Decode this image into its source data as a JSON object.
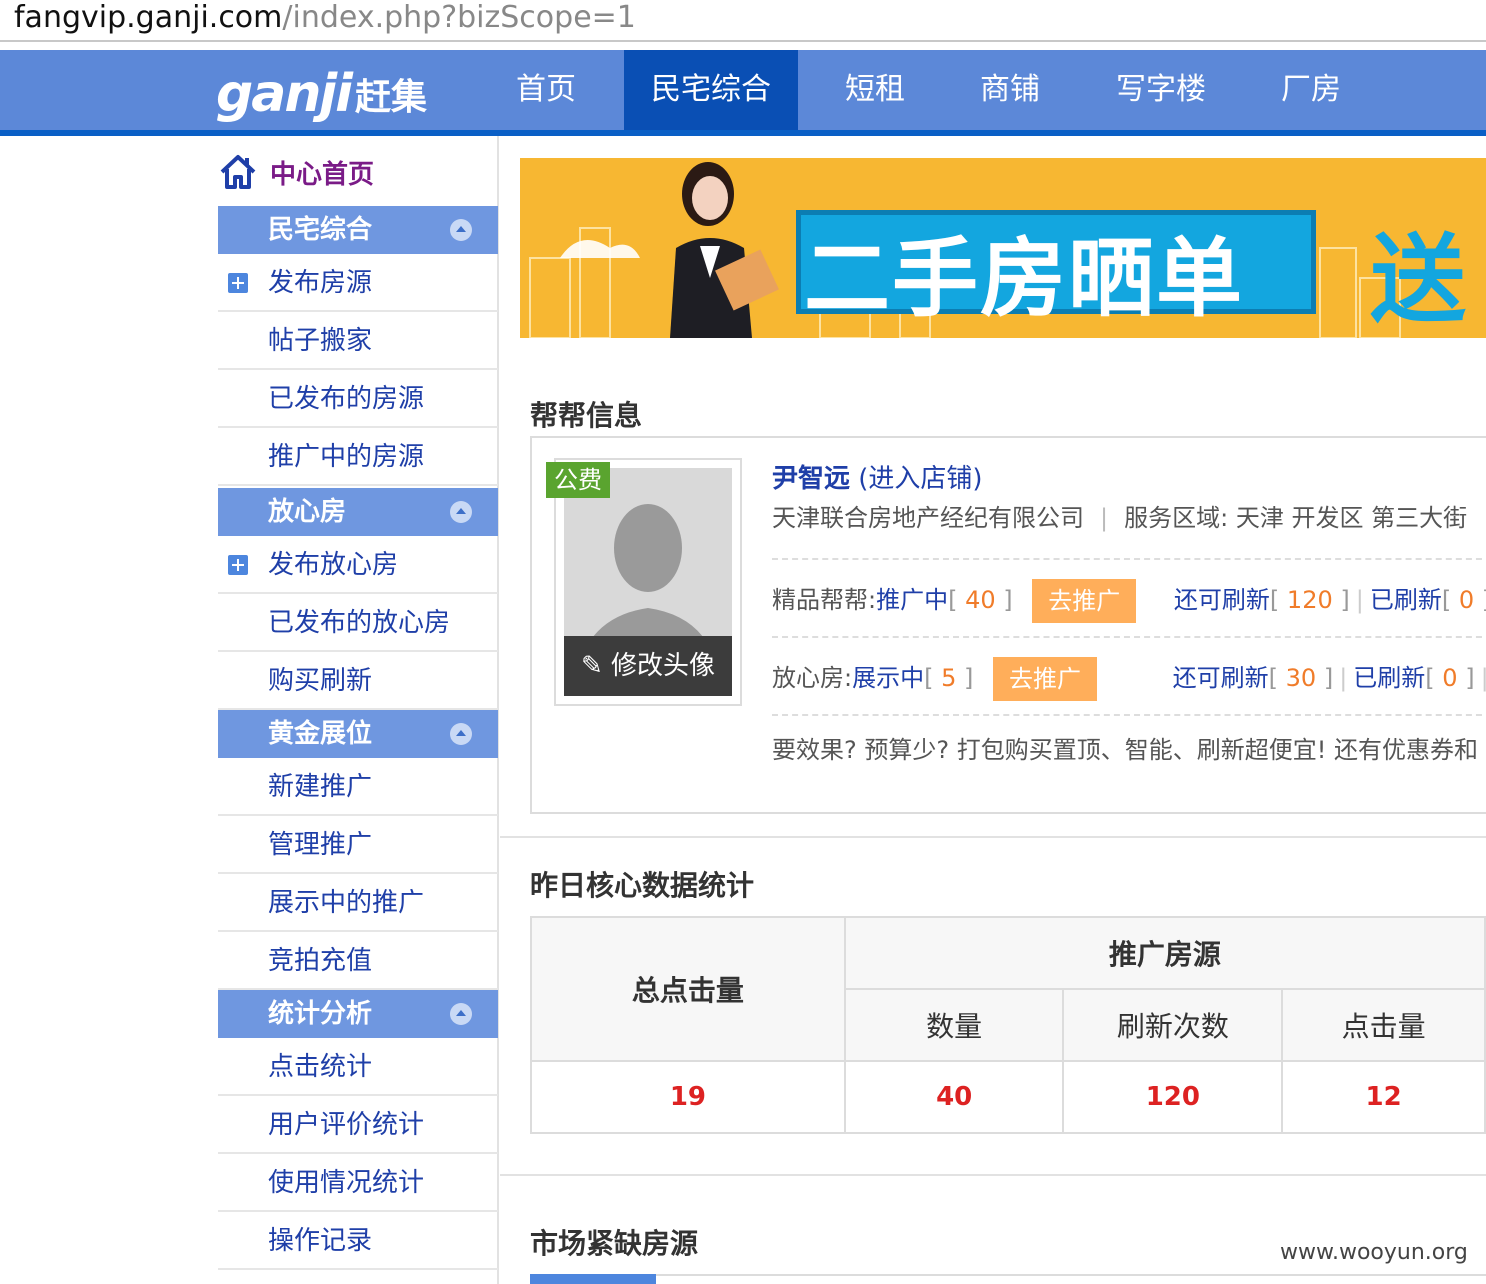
{
  "browser": {
    "url_host": "fangvip.ganji.com",
    "url_rest": "/index.php?bizScope=1"
  },
  "brand": {
    "logo_en": "ganji",
    "logo_cn": "赶集"
  },
  "topnav": {
    "items": [
      {
        "label": "首页"
      },
      {
        "label": "民宅综合"
      },
      {
        "label": "短租"
      },
      {
        "label": "商铺"
      },
      {
        "label": "写字楼"
      },
      {
        "label": "厂房"
      }
    ],
    "active": "民宅综合"
  },
  "sidebar": {
    "home_label": "中心首页",
    "sections": [
      {
        "title": "民宅综合",
        "items": [
          "发布房源",
          "帖子搬家",
          "已发布的房源",
          "推广中的房源"
        ]
      },
      {
        "title": "放心房",
        "items": [
          "发布放心房",
          "已发布的放心房",
          "购买刷新"
        ]
      },
      {
        "title": "黄金展位",
        "items": [
          "新建推广",
          "管理推广",
          "展示中的推广",
          "竞拍充值"
        ]
      },
      {
        "title": "统计分析",
        "items": [
          "点击统计",
          "用户评价统计",
          "使用情况统计",
          "操作记录"
        ]
      }
    ]
  },
  "banner": {
    "title": "二手房晒单",
    "suffix": "送"
  },
  "info": {
    "section_title": "帮帮信息",
    "tag": "公费",
    "edit_avatar": "修改头像",
    "agent_name": "尹智远",
    "shop_link": "(进入店铺)",
    "company": "天津联合房地产经纪有限公司",
    "service_area_label": "服务区域:",
    "service_area": "天津 开发区 第三大街",
    "premium": {
      "label": "精品帮帮:",
      "status": "推广中",
      "count": "40",
      "button": "去推广",
      "refresh_left_label": "还可刷新",
      "refresh_left": "120",
      "refreshed_label": "已刷新",
      "refreshed": "0"
    },
    "trusted": {
      "label": "放心房:",
      "status": "展示中",
      "count": "5",
      "button": "去推广",
      "refresh_left_label": "还可刷新",
      "refresh_left": "30",
      "refreshed_label": "已刷新",
      "refreshed": "0"
    },
    "promo_text": "要效果? 预算少? 打包购买置顶、智能、刷新超便宜! 还有优惠券和"
  },
  "stats": {
    "section_title": "昨日核心数据统计",
    "total_clicks_header": "总点击量",
    "group_header": "推广房源",
    "col_count": "数量",
    "col_refresh": "刷新次数",
    "col_clicks": "点击量",
    "total_clicks": "19",
    "count": "40",
    "refresh": "120",
    "clicks": "12"
  },
  "market": {
    "section_title": "市场紧缺房源"
  },
  "watermark": "www.wooyun.org"
}
